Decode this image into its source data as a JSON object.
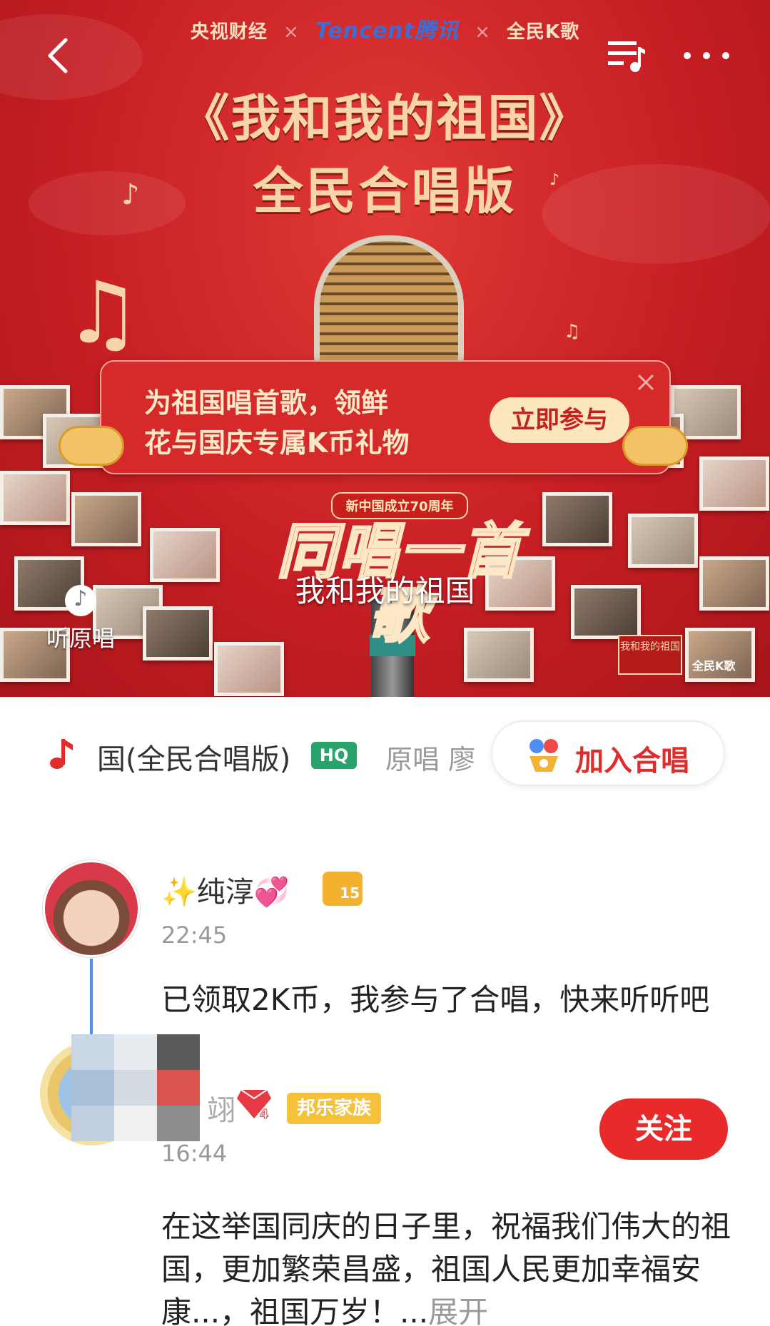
{
  "banner": {
    "partners": [
      "央视财经",
      "Tencent腾讯",
      "全民K歌"
    ],
    "separator": "×",
    "title": "《我和我的祖国》",
    "subtitle": "全民合唱版",
    "emblem_tag": "新中国成立70周年",
    "emblem_text": "同唱一首歌",
    "song_caption": "我和我的祖国",
    "original_label": "听原唱",
    "mini_logo": "我和我的祖国",
    "watermark": "全民K歌"
  },
  "promo": {
    "line1": "为祖国唱首歌，领鲜",
    "line2": "花与国庆专属K币礼物",
    "button": "立即参与"
  },
  "song_bar": {
    "song_name": "国(全民合唱版)",
    "quality_tag": "HQ",
    "original_singer": "原唱 廖",
    "join_button": "加入合唱"
  },
  "feed": [
    {
      "username": "✨纯淳💞",
      "level": "15",
      "time": "22:45",
      "comment": "已领取2K币，我参与了合唱，快来听听吧~"
    },
    {
      "username": "翊",
      "gem_level": "4",
      "family_tag": "邦乐家族",
      "time": "16:44",
      "follow_button": "关注",
      "comment": "在这举国同庆的日子里，祝福我们伟大的祖国，更加繁荣昌盛，祖国人民更加幸福安康...，祖国万岁！...",
      "expand": "展开"
    }
  ],
  "colors": {
    "brand_red": "#e12c2c",
    "banner_red": "#c71f24",
    "gold": "#f6d6a8",
    "hq_green": "#27a36b",
    "thread_blue": "#4f8ef2"
  }
}
